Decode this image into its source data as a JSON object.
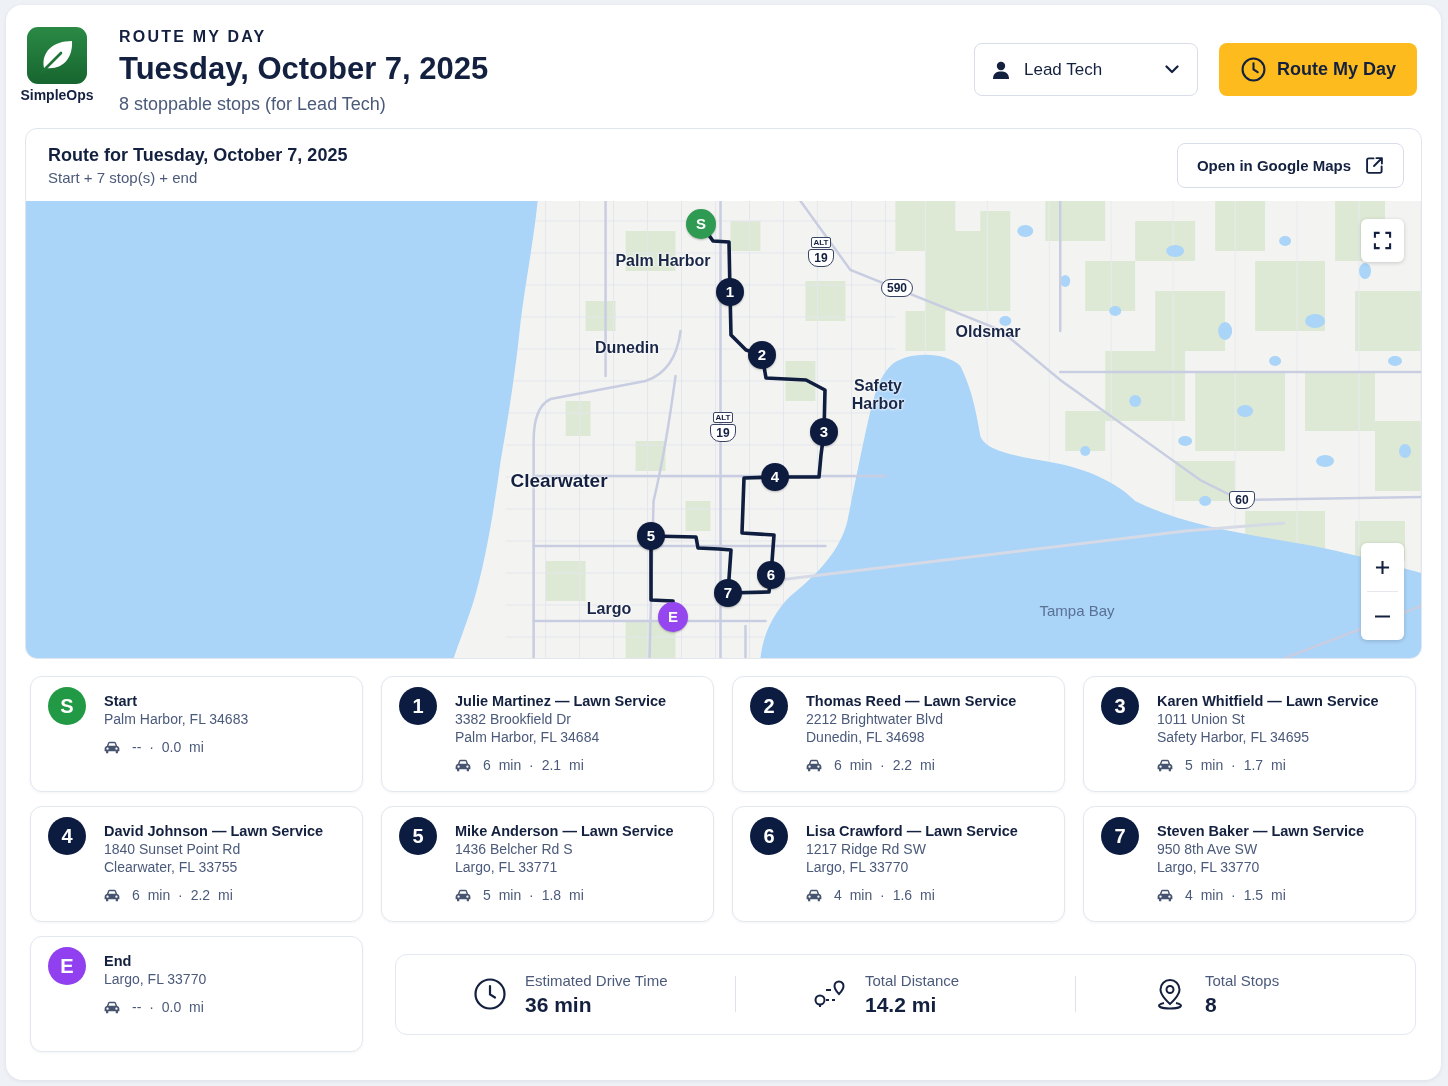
{
  "app": {
    "name": "SimpleOps"
  },
  "header": {
    "eyebrow": "ROUTE MY DAY",
    "title": "Tuesday, October 7, 2025",
    "subtitle": "8 stoppable stops (for Lead Tech)"
  },
  "technician_select": {
    "value": "Lead Tech"
  },
  "route_button": {
    "label": "Route My Day"
  },
  "route_panel": {
    "title": "Route for Tuesday, October 7, 2025",
    "summary": "Start + 7 stop(s) + end",
    "open_maps_button": "Open in Google Maps",
    "map": {
      "places": [
        {
          "name": "Palm Harbor",
          "kind": "town"
        },
        {
          "name": "Dunedin",
          "kind": "town"
        },
        {
          "name": "Clearwater",
          "kind": "city"
        },
        {
          "name": "Largo",
          "kind": "town"
        },
        {
          "name": "Safety Harbor",
          "kind": "town"
        },
        {
          "name": "Oldsmar",
          "kind": "town"
        },
        {
          "name": "Tampa Bay",
          "kind": "water"
        }
      ],
      "shields": [
        {
          "kind": "us",
          "banner": "ALT",
          "number": "19"
        },
        {
          "kind": "us",
          "banner": "ALT",
          "number": "19"
        },
        {
          "kind": "state",
          "number": "590"
        },
        {
          "kind": "us",
          "number": "60"
        }
      ],
      "markers": [
        {
          "kind": "start",
          "label": "S"
        },
        {
          "kind": "stop",
          "label": "1"
        },
        {
          "kind": "stop",
          "label": "2"
        },
        {
          "kind": "stop",
          "label": "3"
        },
        {
          "kind": "stop",
          "label": "4"
        },
        {
          "kind": "stop",
          "label": "5"
        },
        {
          "kind": "stop",
          "label": "6"
        },
        {
          "kind": "stop",
          "label": "7"
        },
        {
          "kind": "end",
          "label": "E"
        }
      ]
    }
  },
  "stops": [
    {
      "kind": "start",
      "badge": "S",
      "title": "Start",
      "address": [
        "Palm Harbor, FL 34683"
      ],
      "drive": "-- · 0.0 mi"
    },
    {
      "kind": "stop",
      "badge": "1",
      "title": "Julie Martinez — Lawn Service",
      "address": [
        "3382 Brookfield Dr",
        "Palm Harbor, FL 34684"
      ],
      "drive": "6 min · 2.1 mi"
    },
    {
      "kind": "stop",
      "badge": "2",
      "title": "Thomas Reed — Lawn Service",
      "address": [
        "2212 Brightwater Blvd",
        "Dunedin, FL 34698"
      ],
      "drive": "6 min · 2.2 mi"
    },
    {
      "kind": "stop",
      "badge": "3",
      "title": "Karen Whitfield — Lawn Service",
      "address": [
        "1011 Union St",
        "Safety Harbor, FL 34695"
      ],
      "drive": "5 min · 1.7 mi"
    },
    {
      "kind": "stop",
      "badge": "4",
      "title": "David Johnson — Lawn Service",
      "address": [
        "1840 Sunset Point Rd",
        "Clearwater, FL 33755"
      ],
      "drive": "6 min · 2.2 mi"
    },
    {
      "kind": "stop",
      "badge": "5",
      "title": "Mike Anderson — Lawn Service",
      "address": [
        "1436 Belcher Rd S",
        "Largo, FL 33771"
      ],
      "drive": "5 min · 1.8 mi"
    },
    {
      "kind": "stop",
      "badge": "6",
      "title": "Lisa Crawford — Lawn Service",
      "address": [
        "1217 Ridge Rd SW",
        "Largo, FL 33770"
      ],
      "drive": "4 min · 1.6 mi"
    },
    {
      "kind": "stop",
      "badge": "7",
      "title": "Steven Baker — Lawn Service",
      "address": [
        "950 8th Ave SW",
        "Largo, FL 33770"
      ],
      "drive": "4 min · 1.5 mi"
    },
    {
      "kind": "end",
      "badge": "E",
      "title": "End",
      "address": [
        "Largo, FL 33770"
      ],
      "drive": "-- · 0.0 mi"
    }
  ],
  "totals": [
    {
      "kind": "time",
      "label": "Estimated Drive Time",
      "value": "36 min"
    },
    {
      "kind": "distance",
      "label": "Total Distance",
      "value": "14.2 mi"
    },
    {
      "kind": "stops",
      "label": "Total Stops",
      "value": "8"
    }
  ]
}
